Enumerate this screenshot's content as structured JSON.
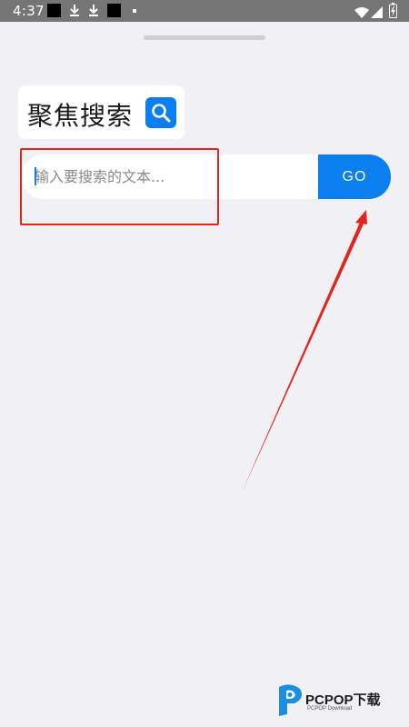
{
  "status_bar": {
    "time": "4:37",
    "icons": [
      "notification-square-icon",
      "download-icon",
      "download-icon",
      "notification-square-icon",
      "dot-icon",
      "wifi-icon",
      "signal-icon",
      "battery-icon"
    ]
  },
  "app": {
    "title": "聚焦搜索",
    "title_icon": "search-icon"
  },
  "search": {
    "placeholder": "输入要搜索的文本...",
    "value": "",
    "go_label": "GO"
  },
  "colors": {
    "accent": "#0b7ef0",
    "background": "#f1f0f5",
    "status_bar": "#757575",
    "annotation": "#e0251d"
  },
  "watermark": {
    "brand": "PCPOP下载",
    "sub": "PCPOP Download"
  }
}
